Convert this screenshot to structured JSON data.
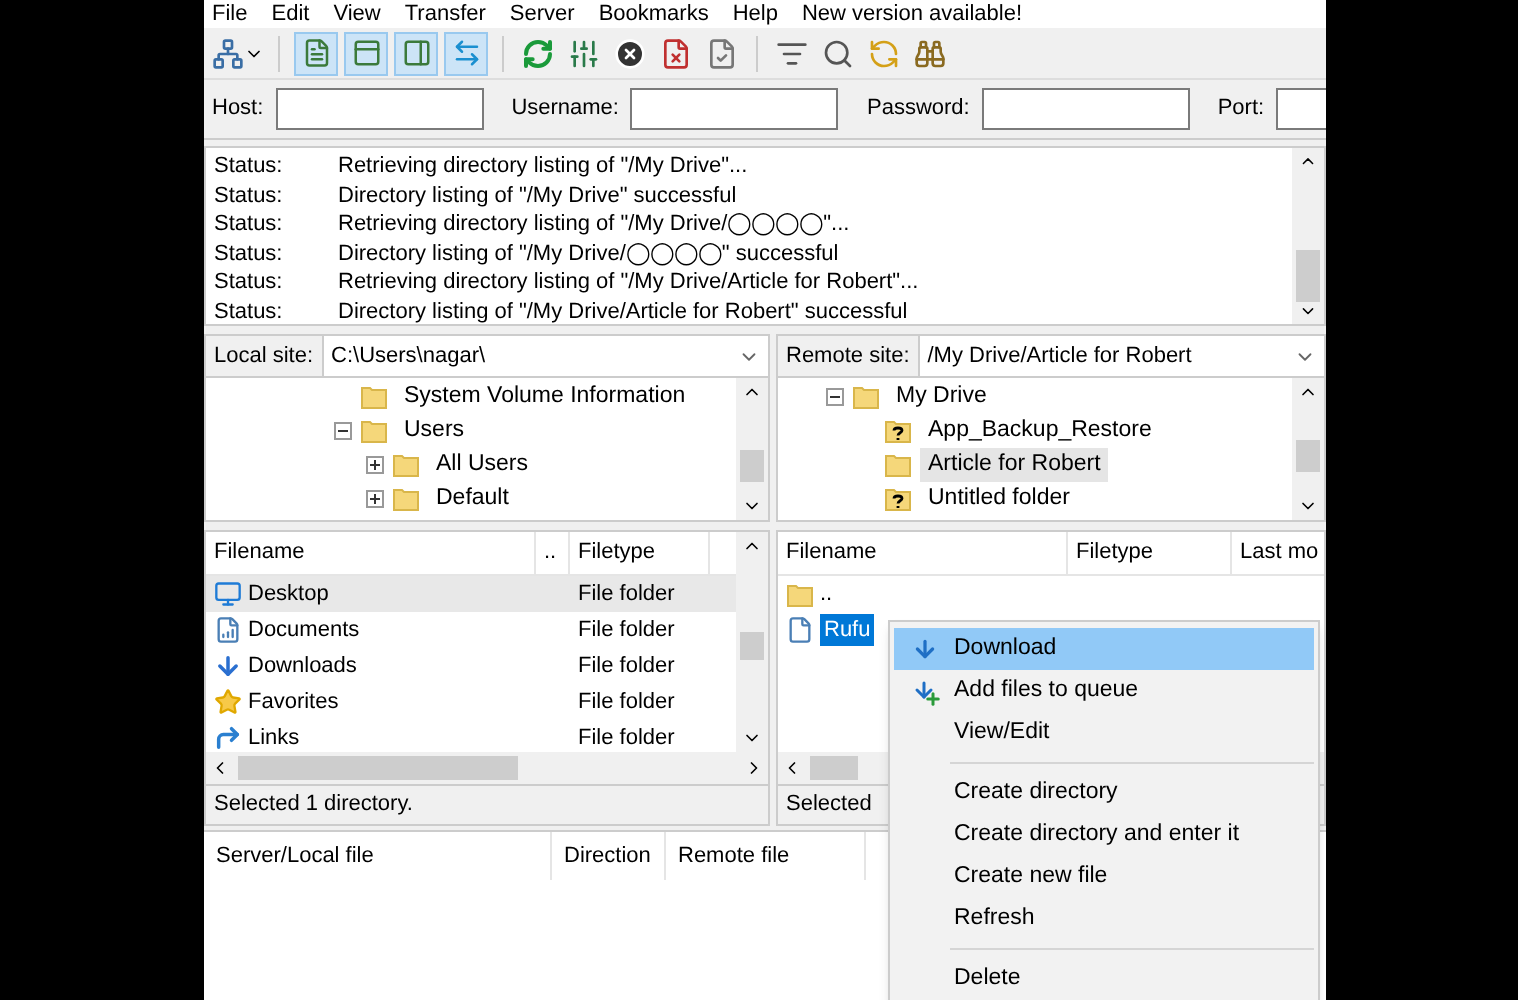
{
  "menu_bar": [
    "File",
    "Edit",
    "View",
    "Transfer",
    "Server",
    "Bookmarks",
    "Help",
    "New version available!"
  ],
  "toolbar": {
    "toggles": [
      {
        "on": true
      },
      {
        "on": true
      },
      {
        "on": true
      },
      {
        "on": true
      }
    ]
  },
  "quickconnect": {
    "fields": [
      {
        "label": "Host:"
      },
      {
        "label": "Username:"
      },
      {
        "label": "Password:"
      },
      {
        "label": "Port:"
      }
    ]
  },
  "message_log": [
    {
      "label": "Status:",
      "message": "Retrieving directory listing of \"/My Drive\"..."
    },
    {
      "label": "Status:",
      "message": "Directory listing of \"/My Drive\" successful"
    },
    {
      "label": "Status:",
      "message": "Retrieving directory listing of \"/My Drive/◯◯◯◯\"..."
    },
    {
      "label": "Status:",
      "message": "Directory listing of \"/My Drive/◯◯◯◯\" successful"
    },
    {
      "label": "Status:",
      "message": "Retrieving directory listing of \"/My Drive/Article for Robert\"..."
    },
    {
      "label": "Status:",
      "message": "Directory listing of \"/My Drive/Article for Robert\" successful"
    }
  ],
  "local": {
    "site_label": "Local site:",
    "path": "C:\\Users\\nagar\\",
    "tree": [
      {
        "label": "System Volume Information",
        "kind": "folder",
        "selected": false
      },
      {
        "label": "Users",
        "kind": "folder",
        "selected": false,
        "expanded": true,
        "children": [
          {
            "label": "All Users",
            "kind": "folder",
            "selected": false,
            "expanded": false
          },
          {
            "label": "Default",
            "kind": "folder",
            "selected": false,
            "expanded": false
          }
        ]
      }
    ],
    "columns": [
      "Filename",
      "..",
      "Filetype"
    ],
    "rows": [
      {
        "kind": "desktop",
        "name": "Desktop",
        "type": "File folder",
        "selected": true
      },
      {
        "kind": "documents",
        "name": "Documents",
        "type": "File folder",
        "selected": false
      },
      {
        "kind": "downloads",
        "name": "Downloads",
        "type": "File folder",
        "selected": false
      },
      {
        "kind": "favorites",
        "name": "Favorites",
        "type": "File folder",
        "selected": false
      },
      {
        "kind": "links",
        "name": "Links",
        "type": "File folder",
        "selected": false
      }
    ],
    "status": "Selected 1 directory."
  },
  "remote": {
    "site_label": "Remote site:",
    "path": "/My Drive/Article for Robert",
    "tree": [
      {
        "label": "My Drive",
        "kind": "folder",
        "selected": false,
        "expanded": true,
        "children": [
          {
            "label": "App_Backup_Restore",
            "kind": "unknown",
            "selected": false
          },
          {
            "label": "Article for Robert",
            "kind": "folder",
            "selected": true
          },
          {
            "label": "Untitled folder",
            "kind": "unknown",
            "selected": false
          }
        ]
      }
    ],
    "columns": [
      "Filename",
      "Filetype",
      "Last mo"
    ],
    "rows": [
      {
        "kind": "folder",
        "name": "..",
        "selected": false
      },
      {
        "kind": "file",
        "name": "Rufu",
        "selected": true
      }
    ],
    "status": "Selected"
  },
  "queue": {
    "columns": [
      "Server/Local file",
      "Direction",
      "Remote file"
    ]
  },
  "context_menu": [
    {
      "kind": "download",
      "label": "Download",
      "selected": true
    },
    {
      "kind": "queue",
      "label": "Add files to queue",
      "selected": false
    },
    {
      "kind": "item",
      "label": "View/Edit",
      "selected": false
    },
    {
      "kind": "separator"
    },
    {
      "kind": "item",
      "label": "Create directory",
      "selected": false
    },
    {
      "kind": "item",
      "label": "Create directory and enter it",
      "selected": false
    },
    {
      "kind": "item",
      "label": "Create new file",
      "selected": false
    },
    {
      "kind": "item",
      "label": "Refresh",
      "selected": false
    },
    {
      "kind": "separator"
    },
    {
      "kind": "item",
      "label": "Delete",
      "selected": false
    }
  ]
}
